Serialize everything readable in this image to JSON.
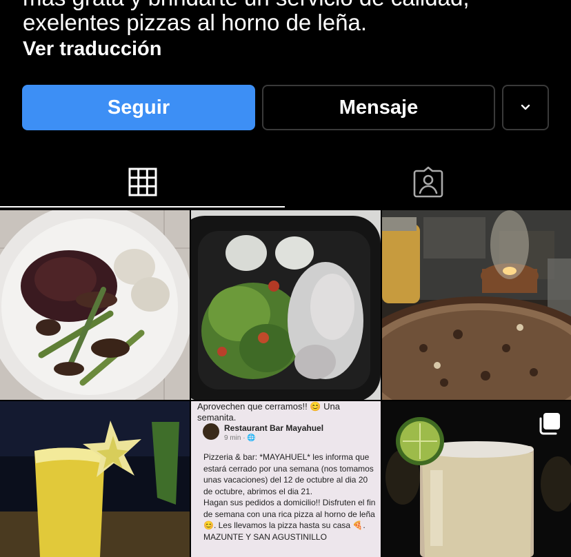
{
  "profile": {
    "bio_line_cut": "más grata y brindarte un servicio de calidad,",
    "bio_line2": "exelentes pizzas al horno de leña.",
    "translate_link": "Ver traducción"
  },
  "actions": {
    "follow_label": "Seguir",
    "message_label": "Mensaje"
  },
  "tabs": [
    {
      "name": "posts-grid",
      "icon": "grid-icon",
      "active": true
    },
    {
      "name": "tagged",
      "icon": "tagged-person-icon",
      "active": false
    }
  ],
  "grid": {
    "post5": {
      "header": "Aprovechen que cerramos!! 😊 Una semanita.",
      "author": "Restaurant Bar Mayahuel",
      "time": "9 min · ",
      "body_1": "Pizzeria & bar: *MAYAHUEL* les informa que estará cerrado por una semana (nos tomamos unas vacaciones) del 12 de octubre al dia 20 de octubre, abrimos el dia 21.",
      "body_2": "Hagan sus pedidos a domicilio!! Disfruten el fin de semana con una rica pizza al horno de leña 😊. Les llevamos la pizza hasta su casa 🍕.",
      "body_3": "MAZUNTE Y SAN AGUSTINILLO"
    }
  },
  "colors": {
    "background": "#000000",
    "follow_button": "#3d8ff5",
    "button_border": "#3a3a3a"
  }
}
